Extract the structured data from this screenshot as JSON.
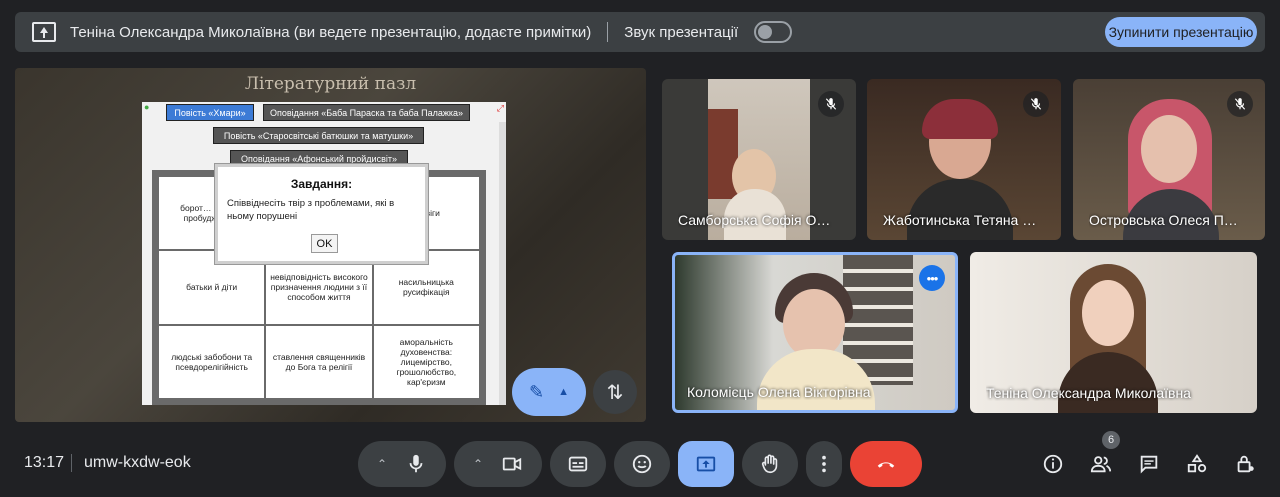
{
  "topbar": {
    "title": "Теніна Олександра Миколаївна (ви ведете презентацію, додаєте примітки)",
    "sound_label": "Звук презентації",
    "stop_label": "Зупинити презентацію"
  },
  "slide": {
    "title": "Літературний пазл",
    "tabs": [
      "Повість «Хмари»",
      "Оповідання «Баба Параска та баба Палажка»",
      "Повість «Старосвітські батюшки та матушки»",
      "Оповідання «Афонський пройдисвіт»"
    ],
    "cells": [
      "борот… націо… пробудженн…",
      "",
      "…свіги",
      "батьки й діти",
      "невідповідність високого призначення людини з її способом життя",
      "насильницька русифікація",
      "людські забобони та псевдорелігійність",
      "ставлення священників до Бога та релігії",
      "аморальність духовенства: лицемірство, грошолюбство, кар'єризм"
    ],
    "dialog": {
      "title": "Завдання:",
      "text": "Співвіднесіть твір з проблемами, які в ньому порушені",
      "ok": "OK"
    }
  },
  "participants": [
    {
      "name": "Самборська Софія О…",
      "muted": true
    },
    {
      "name": "Жаботинська Тетяна …",
      "muted": true
    },
    {
      "name": "Островська Олеся П…",
      "muted": true
    },
    {
      "name": "Коломієць Олена Вікторівна",
      "muted": false,
      "speaking": true
    },
    {
      "name": "Теніна Олександра Миколаївна",
      "muted": false
    }
  ],
  "bottombar": {
    "time": "13:17",
    "meeting_code": "umw-kxdw-eok",
    "people_count": "6"
  },
  "colors": {
    "accent": "#8ab4f8",
    "end_call": "#ea4335",
    "bar": "#3c4043"
  }
}
